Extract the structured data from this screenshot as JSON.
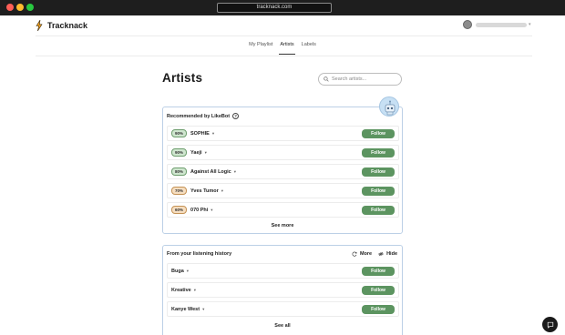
{
  "browser": {
    "url": "tracknack.com"
  },
  "app": {
    "name": "Tracknack"
  },
  "nav": {
    "tabs": [
      {
        "label": "My Playlist",
        "active": false
      },
      {
        "label": "Artists",
        "active": true
      },
      {
        "label": "Labels",
        "active": false
      }
    ]
  },
  "page": {
    "title": "Artists"
  },
  "search": {
    "placeholder": "Search artists..."
  },
  "recommended": {
    "title": "Recommended by LikeBot",
    "rows": [
      {
        "match": "90%",
        "name": "SOPHIE",
        "button": "Follow",
        "tone": "green"
      },
      {
        "match": "90%",
        "name": "Yaeji",
        "button": "Follow",
        "tone": "green"
      },
      {
        "match": "80%",
        "name": "Against All Logic",
        "button": "Follow",
        "tone": "green"
      },
      {
        "match": "70%",
        "name": "Yves Tumor",
        "button": "Follow",
        "tone": "orange"
      },
      {
        "match": "60%",
        "name": "070 Phi",
        "button": "Follow",
        "tone": "orange"
      }
    ],
    "see_more": "See more"
  },
  "history": {
    "title": "From your listening history",
    "more_label": "More",
    "hide_label": "Hide",
    "rows": [
      {
        "name": "Buga",
        "button": "Follow"
      },
      {
        "name": "Kreative",
        "button": "Follow"
      },
      {
        "name": "Kanye West",
        "button": "Follow"
      }
    ],
    "see_all": "See all"
  },
  "colors": {
    "follow_button": "#5c9460",
    "card_border": "#bcd0e6",
    "match_high": "#cfe6cf",
    "match_mid": "#f6dec0"
  }
}
